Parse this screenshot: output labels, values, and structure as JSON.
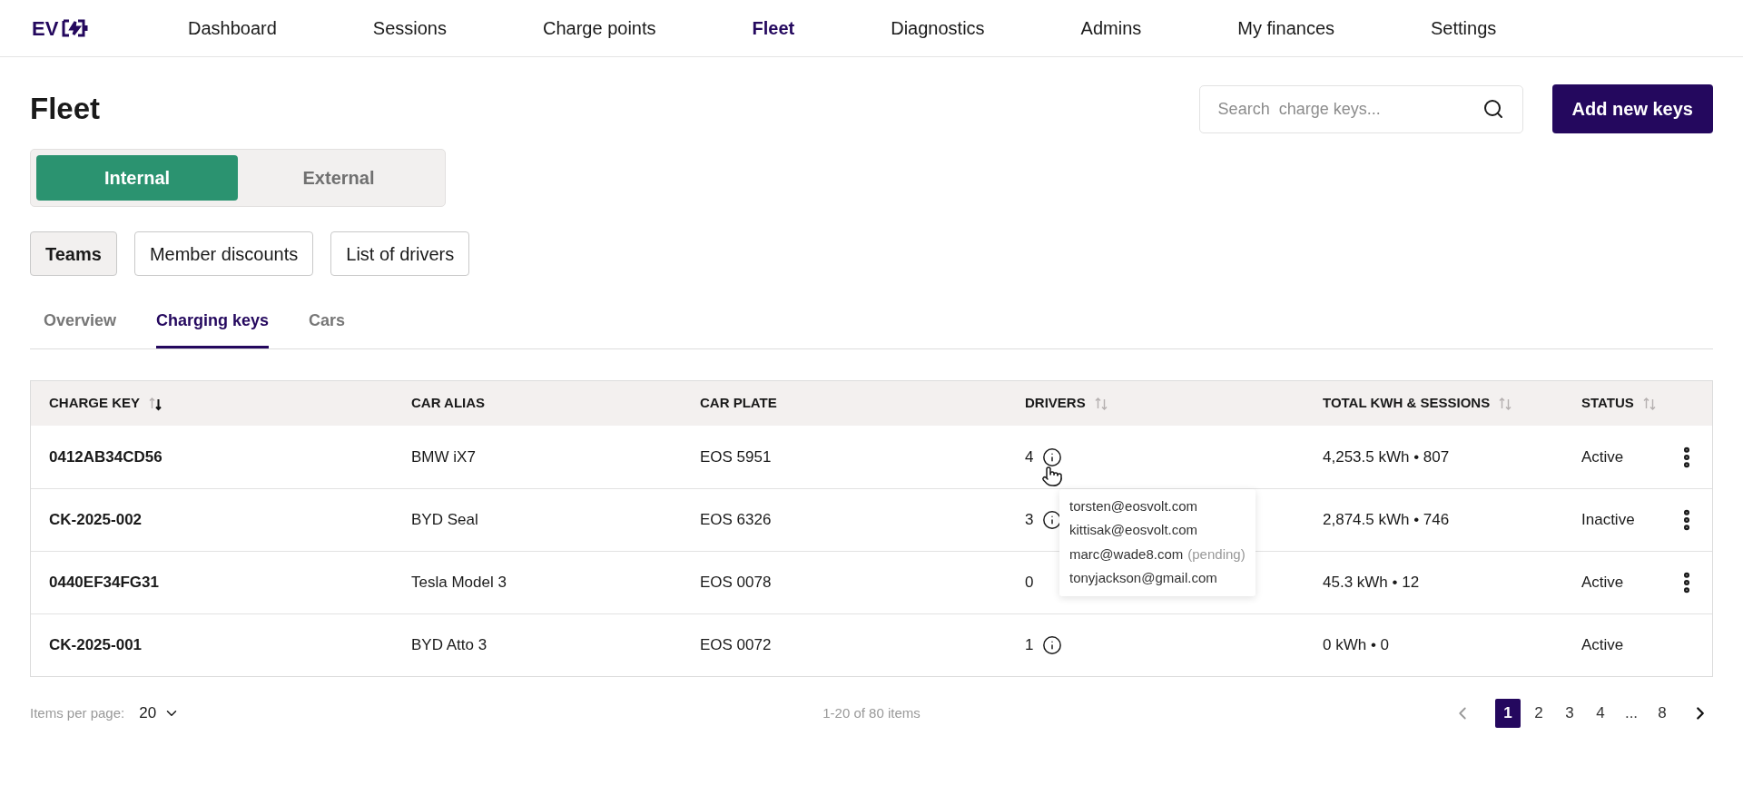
{
  "nav": {
    "logo": "EV",
    "items": [
      {
        "label": "Dashboard",
        "selected": false
      },
      {
        "label": "Sessions",
        "selected": false
      },
      {
        "label": "Charge points",
        "selected": false
      },
      {
        "label": "Fleet",
        "selected": true
      },
      {
        "label": "Diagnostics",
        "selected": false
      },
      {
        "label": "Admins",
        "selected": false
      },
      {
        "label": "My finances",
        "selected": false
      },
      {
        "label": "Settings",
        "selected": false
      }
    ]
  },
  "page_title": "Fleet",
  "search": {
    "placeholder": "Search  charge keys..."
  },
  "add_button": "Add new keys",
  "segments": [
    {
      "label": "Internal",
      "selected": true
    },
    {
      "label": "External",
      "selected": false
    }
  ],
  "chips": [
    {
      "label": "Teams",
      "selected": true
    },
    {
      "label": "Member discounts",
      "selected": false
    },
    {
      "label": "List of drivers",
      "selected": false
    }
  ],
  "tabs": [
    {
      "label": "Overview",
      "selected": false
    },
    {
      "label": "Charging keys",
      "selected": true
    },
    {
      "label": "Cars",
      "selected": false
    }
  ],
  "table": {
    "columns": [
      {
        "label": "CHARGE KEY",
        "sortable": true,
        "sorted_desc": true
      },
      {
        "label": "CAR ALIAS",
        "sortable": false
      },
      {
        "label": "CAR PLATE",
        "sortable": false
      },
      {
        "label": "DRIVERS",
        "sortable": true,
        "sorted_desc": false
      },
      {
        "label": "TOTAL KWH & SESSIONS",
        "sortable": true,
        "sorted_desc": false
      },
      {
        "label": "STATUS",
        "sortable": true,
        "sorted_desc": false
      }
    ],
    "rows": [
      {
        "charge_key": "0412AB34CD56",
        "car_alias": "BMW iX7",
        "car_plate": "EOS 5951",
        "drivers": "4",
        "drivers_info": true,
        "total": "4,253.5 kWh • 807",
        "status": "Active",
        "has_menu": true,
        "tooltip": [
          {
            "email": "torsten@eosvolt.com"
          },
          {
            "email": "kittisak@eosvolt.com"
          },
          {
            "email": "marc@wade8.com",
            "note": "(pending)"
          },
          {
            "email": "tonyjackson@gmail.com"
          }
        ]
      },
      {
        "charge_key": "CK-2025-002",
        "car_alias": "BYD Seal",
        "car_plate": "EOS 6326",
        "drivers": "3",
        "drivers_info": true,
        "total": "2,874.5 kWh • 746",
        "status": "Inactive",
        "has_menu": true
      },
      {
        "charge_key": "0440EF34FG31",
        "car_alias": "Tesla Model 3",
        "car_plate": "EOS 0078",
        "drivers": "0",
        "drivers_info": false,
        "total": "45.3 kWh • 12",
        "status": "Active",
        "has_menu": true
      },
      {
        "charge_key": "CK-2025-001",
        "car_alias": "BYD Atto 3",
        "car_plate": "EOS 0072",
        "drivers": "1",
        "drivers_info": true,
        "total": "0 kWh • 0",
        "status": "Active",
        "has_menu": false
      }
    ]
  },
  "footer": {
    "items_per_page_label": "Items per page:",
    "items_per_page": "20",
    "range": "1-20 of 80 items",
    "prev_disabled": true,
    "next_disabled": false,
    "pages": [
      {
        "label": "1",
        "selected": true
      },
      {
        "label": "2",
        "selected": false
      },
      {
        "label": "3",
        "selected": false
      },
      {
        "label": "4",
        "selected": false
      },
      {
        "label": "...",
        "selected": false
      },
      {
        "label": "8",
        "selected": false
      }
    ]
  }
}
